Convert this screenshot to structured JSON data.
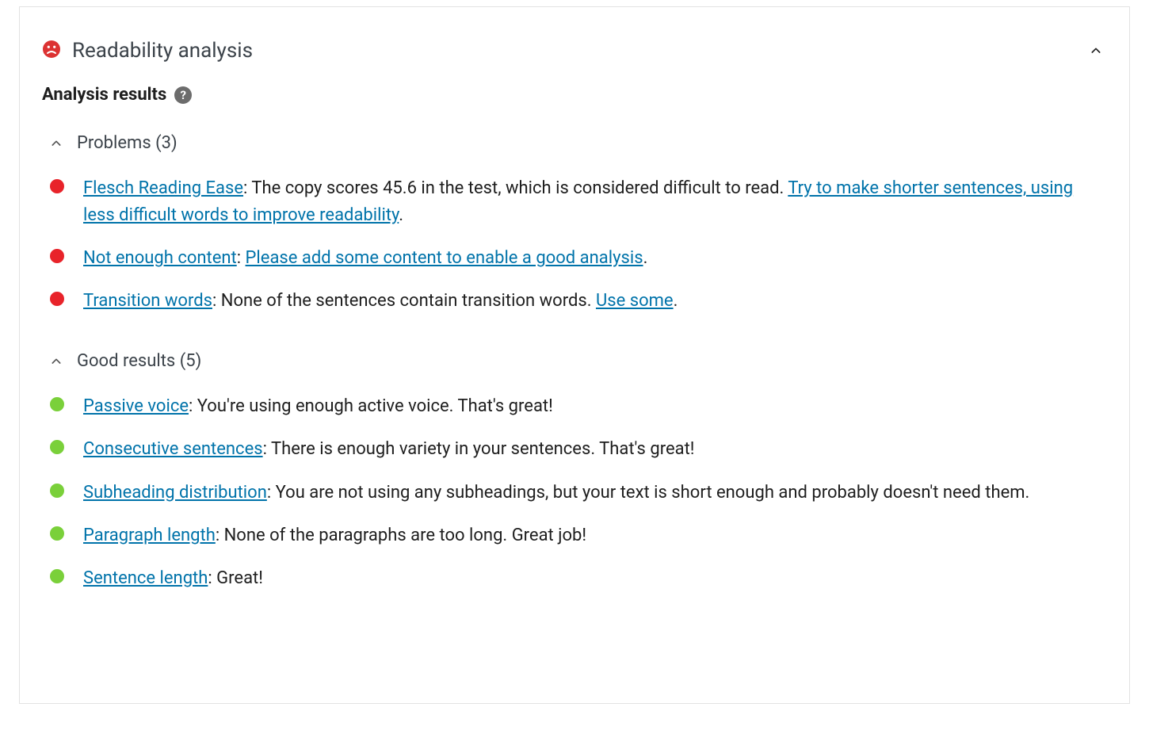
{
  "panel": {
    "title": "Readability analysis",
    "sub_head": "Analysis results"
  },
  "sections": {
    "problems": {
      "label": "Problems (3)",
      "items": [
        {
          "lead_link": "Flesch Reading Ease",
          "mid": ": The copy scores 45.6 in the test, which is considered difficult to read. ",
          "action_link": "Try to make shorter sentences, using less difficult words to improve readability",
          "tail": "."
        },
        {
          "lead_link": "Not enough content",
          "mid": ": ",
          "action_link": "Please add some content to enable a good analysis",
          "tail": "."
        },
        {
          "lead_link": "Transition words",
          "mid": ": None of the sentences contain transition words. ",
          "action_link": "Use some",
          "tail": "."
        }
      ]
    },
    "good": {
      "label": "Good results (5)",
      "items": [
        {
          "lead_link": "Passive voice",
          "mid": ": You're using enough active voice. That's great!",
          "action_link": "",
          "tail": ""
        },
        {
          "lead_link": "Consecutive sentences",
          "mid": ": There is enough variety in your sentences. That's great!",
          "action_link": "",
          "tail": ""
        },
        {
          "lead_link": "Subheading distribution",
          "mid": ": You are not using any subheadings, but your text is short enough and probably doesn't need them.",
          "action_link": "",
          "tail": ""
        },
        {
          "lead_link": "Paragraph length",
          "mid": ": None of the paragraphs are too long. Great job!",
          "action_link": "",
          "tail": ""
        },
        {
          "lead_link": "Sentence length",
          "mid": ": Great!",
          "action_link": "",
          "tail": ""
        }
      ]
    }
  }
}
